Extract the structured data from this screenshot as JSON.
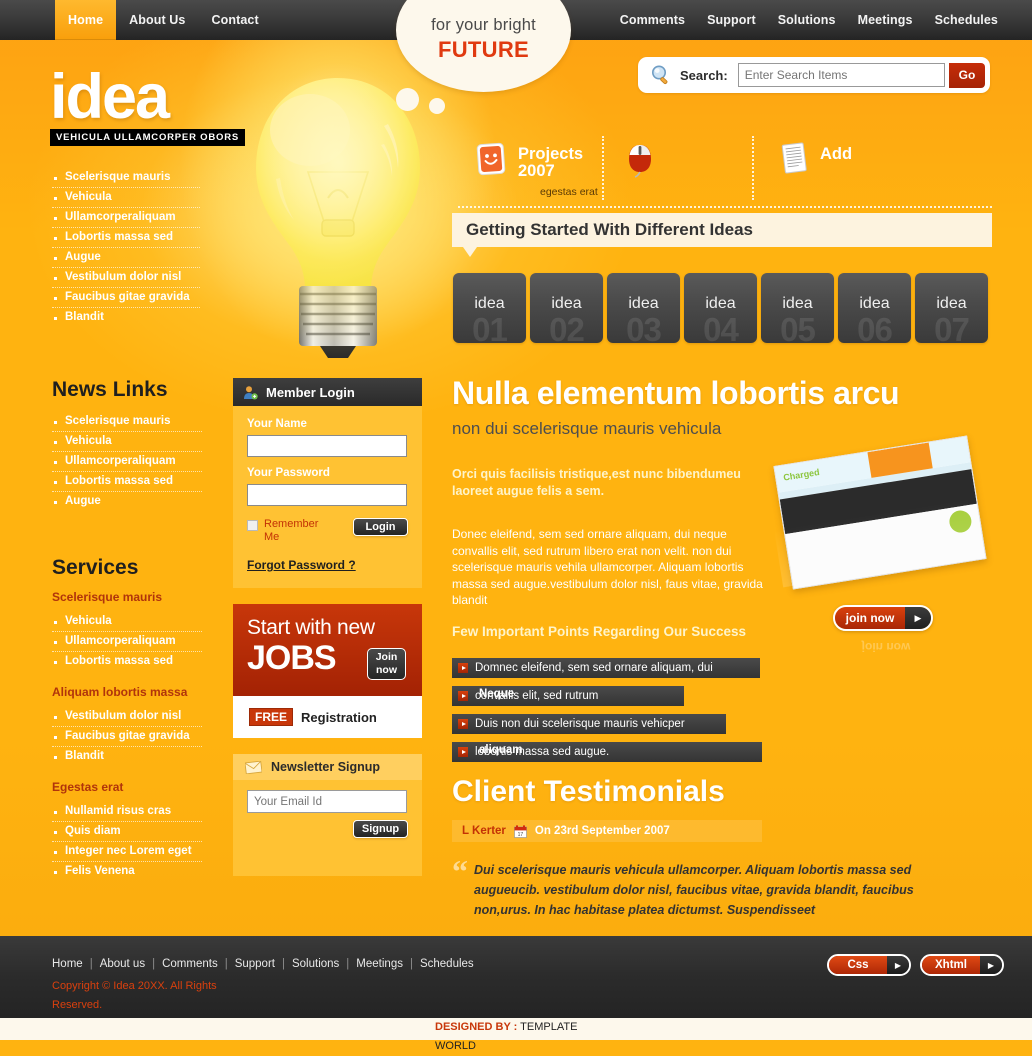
{
  "nav": {
    "left": [
      {
        "label": "Home",
        "active": true
      },
      {
        "label": "About Us",
        "active": false
      },
      {
        "label": "Contact",
        "active": false
      }
    ],
    "right": [
      {
        "label": "Comments"
      },
      {
        "label": "Support"
      },
      {
        "label": "Solutions"
      },
      {
        "label": "Meetings"
      },
      {
        "label": "Schedules"
      }
    ]
  },
  "bubble": {
    "line1": "for your bright",
    "line2": "FUTURE"
  },
  "logo": {
    "word": "idea",
    "tagline": "VEHICULA ULLAMCORPER OBORS"
  },
  "left_menu": [
    "Scelerisque mauris",
    "Vehicula",
    "Ullamcorperaliquam",
    "Lobortis massa sed",
    "Augue",
    "Vestibulum dolor nisl",
    "Faucibus gitae gravida",
    "Blandit"
  ],
  "news_links": {
    "title": "News Links",
    "items": [
      "Scelerisque mauris",
      "Vehicula",
      "Ullamcorperaliquam",
      "Lobortis massa sed",
      "Augue"
    ]
  },
  "services": {
    "title": "Services",
    "groups": [
      {
        "heading": "Scelerisque mauris",
        "items": [
          "Vehicula",
          "Ullamcorperaliquam",
          "Lobortis massa sed"
        ]
      },
      {
        "heading": "Aliquam lobortis massa",
        "items": [
          "Vestibulum dolor nisl",
          "Faucibus gitae gravida",
          "Blandit"
        ]
      },
      {
        "heading": "Egestas erat",
        "items": [
          "Nullamid risus cras",
          "Quis diam",
          "Integer nec Lorem eget",
          "Felis Venena"
        ]
      }
    ]
  },
  "search": {
    "label": "Search:",
    "placeholder": "Enter Search Items",
    "value": "",
    "button": "Go"
  },
  "features": [
    {
      "icon": "smiley-card-icon",
      "title": "Projects 2007",
      "subtitle": "egestas erat"
    },
    {
      "icon": "mouse-icon",
      "title": "",
      "subtitle": ""
    },
    {
      "icon": "document-icon",
      "title": "Add",
      "subtitle": ""
    }
  ],
  "getting_started": {
    "title": "Getting Started With Different Ideas"
  },
  "thumbnails": [
    {
      "label": "idea",
      "number": "01"
    },
    {
      "label": "idea",
      "number": "02"
    },
    {
      "label": "idea",
      "number": "03"
    },
    {
      "label": "idea",
      "number": "04"
    },
    {
      "label": "idea",
      "number": "05"
    },
    {
      "label": "idea",
      "number": "06"
    },
    {
      "label": "idea",
      "number": "07"
    }
  ],
  "main": {
    "heading": "Nulla elementum lobortis arcu",
    "subheading": "non dui scelerisque mauris vehicula",
    "lead": "Orci quis facilisis tristique,est nunc bibendumeu laoreet augue felis a sem.",
    "body": "Donec eleifend, sem sed ornare aliquam, dui neque convallis elit, sed rutrum libero erat non velit. non dui scelerisque mauris vehila ullamcorper. Aliquam lobortis massa sed augue.vestibulum dolor nisl, faus vitae, gravida blandit",
    "points_heading": "Few Important Points Regarding Our Success",
    "points": [
      {
        "text": "Domnec eleifend, sem sed ornare aliquam, dui",
        "wrap": ""
      },
      {
        "text": "convallis elit, sed rutrum",
        "wrap": "Neque"
      },
      {
        "text": "Duis non dui scelerisque mauris vehicper",
        "wrap": ""
      },
      {
        "text": "lobortis massa sed augue.",
        "wrap": "aliquam"
      }
    ]
  },
  "promo": {
    "join_label": "join now",
    "join_arrow": "▶",
    "reflection_label": "join now"
  },
  "testimonials": {
    "title": "Client Testimonials",
    "author": "L Kerter",
    "date": "On 23rd September 2007",
    "quote_mark": "“",
    "quote": "Dui scelerisque mauris vehicula ullamcorper. Aliquam lobortis massa sed augueucib. vestibulum dolor nisl, faucibus vitae, gravida blandit, faucibus non,urus. In hac habitase platea dictumst. Suspendisseet"
  },
  "member_login": {
    "title": "Member Login",
    "name_label": "Your Name",
    "name_value": "",
    "password_label": "Your Password",
    "password_value": "",
    "remember_label": "Remember Me",
    "login_button": "Login",
    "forgot_link": "Forgot Password ?"
  },
  "jobs": {
    "line1": "Start with new",
    "line2": "JOBS",
    "button_line1": "Join",
    "button_line2": "now",
    "free_badge": "FREE",
    "registration_text": "Registration"
  },
  "newsletter": {
    "title": "Newsletter Signup",
    "placeholder": "Your Email Id",
    "value": "",
    "button": "Signup"
  },
  "footer": {
    "links": [
      "Home",
      "About us",
      "Comments",
      "Support",
      "Solutions",
      "Meetings",
      "Schedules"
    ],
    "separator": "|",
    "copyright": "Copyright © Idea 20XX. All Rights Reserved.",
    "buttons": [
      {
        "label": "Css",
        "arrow": "▶"
      },
      {
        "label": "Xhtml",
        "arrow": "▶"
      }
    ]
  },
  "credit": {
    "designed_by": "DESIGNED BY :",
    "template": "TEMPLATE",
    "world": "WORLD"
  },
  "colors": {
    "page_orange": "#FFB310",
    "dark_bar": "#2b2b2b",
    "accent_red": "#C8370A",
    "panel_yellow": "#FFC233",
    "cream": "#FDF3DF"
  }
}
